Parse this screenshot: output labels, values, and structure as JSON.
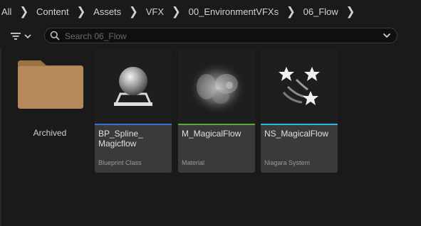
{
  "breadcrumb": {
    "items": [
      "All",
      "Content",
      "Assets",
      "VFX",
      "00_EnvironmentVFXs",
      "06_Flow"
    ]
  },
  "search": {
    "placeholder": "Search 06_Flow",
    "value": ""
  },
  "folders": [
    {
      "name": "Archived"
    }
  ],
  "assets": [
    {
      "title": "BP_Spline_\nMagicflow",
      "type": "Blueprint Class",
      "accent": "#3b6fd9",
      "icon": "sphere-on-pedestal-icon"
    },
    {
      "title": "M_MagicalFlow",
      "type": "Material",
      "accent": "#5aaa34",
      "icon": "material-noise-thumbnail"
    },
    {
      "title": "NS_MagicalFlow",
      "type": "Niagara System",
      "accent": "#29b6e3",
      "icon": "stars-icon"
    }
  ],
  "colors": {
    "background": "#1a1a1a",
    "card": "#3a3a3a",
    "folder": "#b5895a"
  }
}
